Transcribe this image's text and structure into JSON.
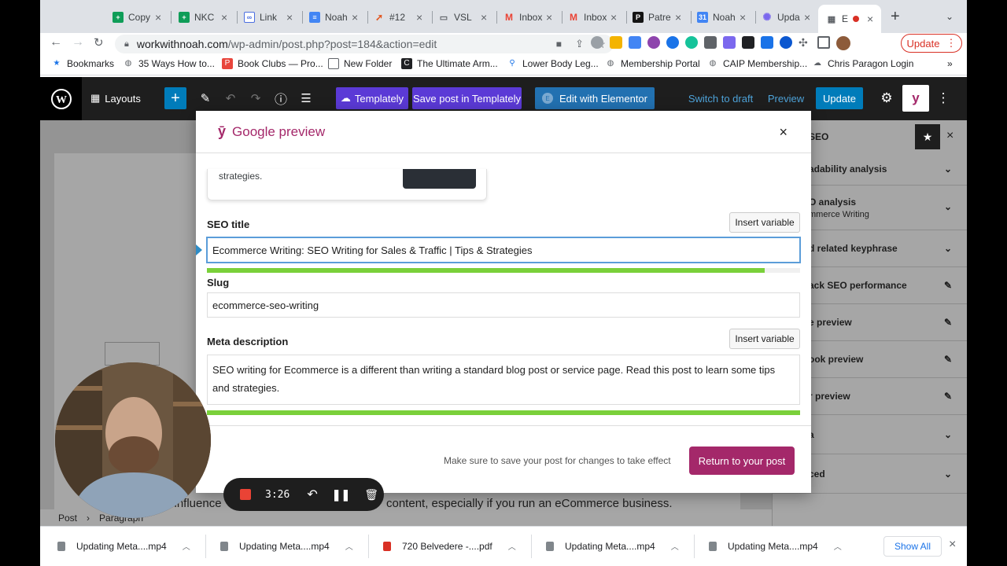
{
  "browser": {
    "tabs": [
      {
        "title": "Copy",
        "icon": "sheets-icon",
        "color": "#0f9d58"
      },
      {
        "title": "NKC",
        "icon": "sheets-icon",
        "color": "#0f9d58"
      },
      {
        "title": "Link",
        "icon": "link-icon",
        "color": "#4a6ee0"
      },
      {
        "title": "Noah",
        "icon": "docs-icon",
        "color": "#4285f4"
      },
      {
        "title": "#12",
        "icon": "rocket-icon",
        "color": "#e25822"
      },
      {
        "title": "VSL",
        "icon": "book-icon",
        "color": "#5f6368"
      },
      {
        "title": "Inbox",
        "icon": "gmail-icon",
        "color": "#ea4335"
      },
      {
        "title": "Inbox",
        "icon": "gmail-icon",
        "color": "#ea4335"
      },
      {
        "title": "Patre",
        "icon": "patreon-icon",
        "color": "#141414"
      },
      {
        "title": "Noah",
        "icon": "calendar-icon",
        "color": "#4285f4"
      },
      {
        "title": "Upda",
        "icon": "star-icon",
        "color": "#7b68ee"
      },
      {
        "title": "E",
        "icon": "grid-icon",
        "color": "#5f6368"
      }
    ],
    "new_tab": "+",
    "url_host": "workwithnoah.com",
    "url_path": "/wp-admin/post.php?post=184&action=edit",
    "update_label": "Update",
    "bookmarks": [
      {
        "label": "Bookmarks",
        "icon": "star-icon"
      },
      {
        "label": "35 Ways How to...",
        "icon": "globe-icon"
      },
      {
        "label": "Book Clubs — Pro...",
        "icon": "bookmark-icon"
      },
      {
        "label": "New Folder",
        "icon": "folder-icon"
      },
      {
        "label": "The Ultimate Arm...",
        "icon": "c-icon"
      },
      {
        "label": "Lower Body Leg...",
        "icon": "figure-icon"
      },
      {
        "label": "Membership Portal",
        "icon": "globe-icon"
      },
      {
        "label": "CAIP Membership...",
        "icon": "globe-icon"
      },
      {
        "label": "Chris Paragon Login",
        "icon": "cloud-icon"
      }
    ],
    "bookmarks_more": "»"
  },
  "wp": {
    "layouts_label": "Layouts",
    "templately_label": "Templately",
    "save_templately_label": "Save post in Templately",
    "elementor_label": "Edit with Elementor",
    "switch_draft_label": "Switch to draft",
    "preview_label": "Preview",
    "update_label": "Update",
    "accent": "#007cba",
    "templately_color": "#5b3ad6"
  },
  "sidebar": {
    "title": "SEO",
    "rows": [
      {
        "label": "adability analysis",
        "action": "chevron-down-icon"
      },
      {
        "label": "O analysis",
        "sub": "mmerce Writing",
        "action": "chevron-down-icon"
      },
      {
        "label": "d related keyphrase",
        "action": "chevron-down-icon"
      },
      {
        "label": "ack SEO performance",
        "action": "edit-icon"
      },
      {
        "label": "e preview",
        "action": "edit-icon"
      },
      {
        "label": "ook preview",
        "action": "edit-icon"
      },
      {
        "label": "r preview",
        "action": "edit-icon"
      },
      {
        "label": "a",
        "action": "chevron-down-icon"
      },
      {
        "label": "ced",
        "action": "chevron-down-icon"
      }
    ]
  },
  "editor": {
    "body_snippet": "o influence",
    "body_snippet2": "content, especially if you run an eCommerce business.",
    "breadcrumb_post": "Post",
    "breadcrumb_sep": "›",
    "breadcrumb_block": "Paragraph"
  },
  "modal": {
    "title": "Google preview",
    "brand_color": "#a4286a",
    "preview_text": "strategies.",
    "seo_title_label": "SEO title",
    "insert_variable_label": "Insert variable",
    "seo_title_value": "Ecommerce Writing: SEO Writing for Sales & Traffic | Tips & Strategies",
    "seo_title_progress": 0.94,
    "slug_label": "Slug",
    "slug_value": "ecommerce-seo-writing",
    "meta_label": "Meta description",
    "meta_value": "SEO writing for Ecommerce is a different than writing a standard blog post or service page. Read this post to learn some tips and strategies.",
    "meta_progress": 1.0,
    "footer_note": "Make sure to save your post for changes to take effect",
    "return_label": "Return to your post"
  },
  "recorder": {
    "time": "3:26"
  },
  "downloads": {
    "items": [
      {
        "name": "Updating Meta....mp4"
      },
      {
        "name": "Updating Meta....mp4"
      },
      {
        "name": "720 Belvedere -....pdf"
      },
      {
        "name": "Updating Meta....mp4"
      },
      {
        "name": "Updating Meta....mp4"
      }
    ],
    "show_all": "Show All"
  }
}
